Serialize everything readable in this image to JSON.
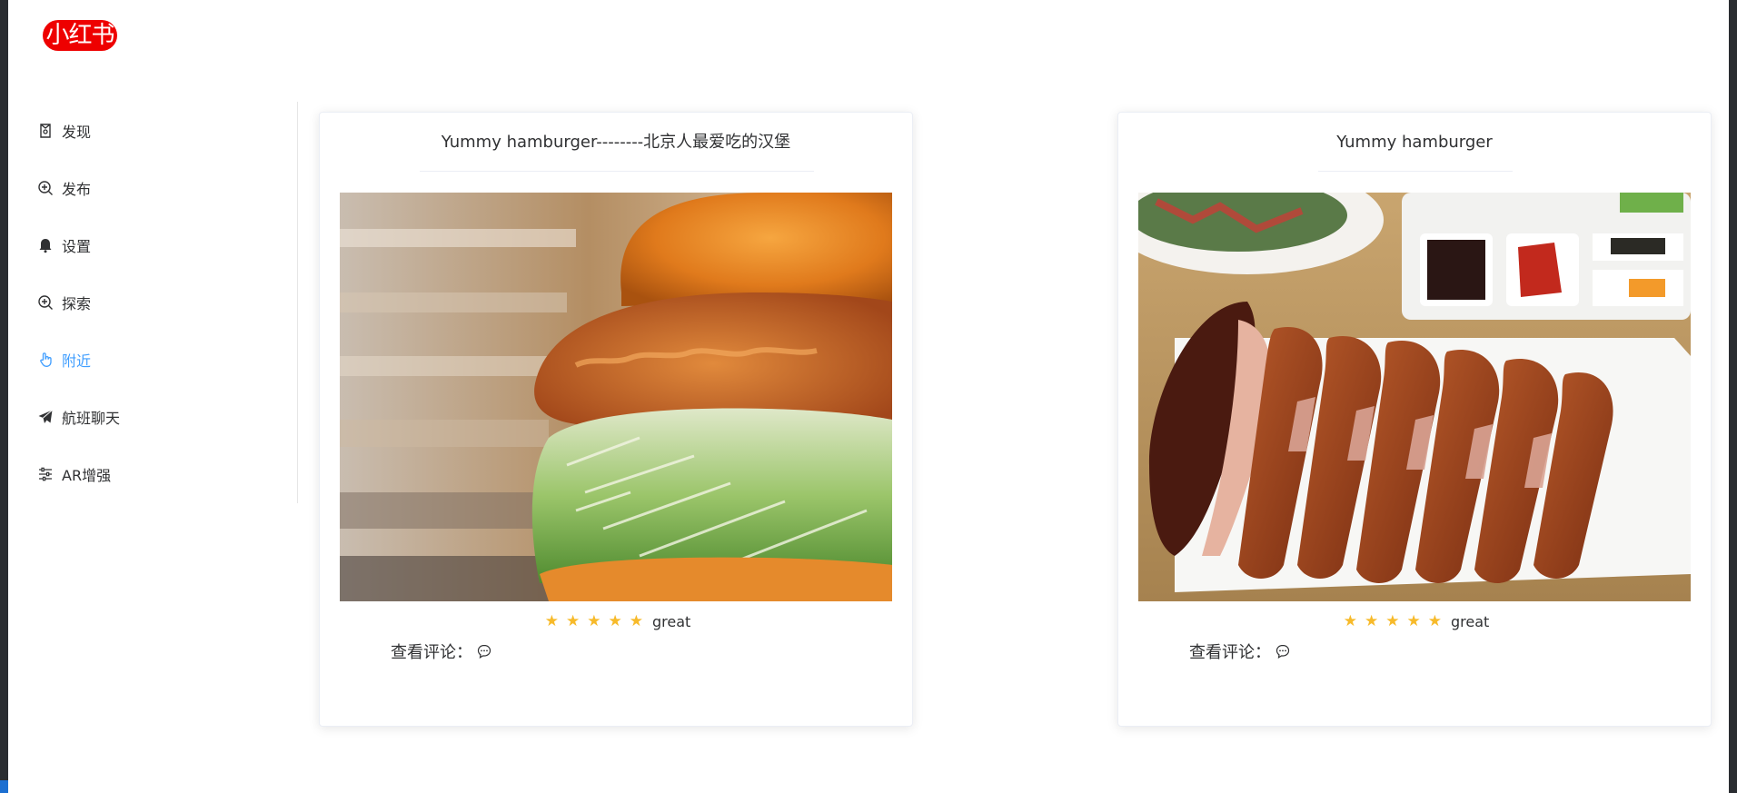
{
  "app": {
    "logo_text": "小红书",
    "brand_color": "#ee0000",
    "accent_color": "#409eff"
  },
  "sidebar": {
    "items": [
      {
        "label": "发现",
        "icon": "discover-icon",
        "active": false
      },
      {
        "label": "发布",
        "icon": "publish-icon",
        "active": false
      },
      {
        "label": "设置",
        "icon": "bell-icon",
        "active": false
      },
      {
        "label": "探索",
        "icon": "zoom-icon",
        "active": false
      },
      {
        "label": "附近",
        "icon": "pointer-icon",
        "active": true
      },
      {
        "label": "航班聊天",
        "icon": "paper-plane-icon",
        "active": false
      },
      {
        "label": "AR增强",
        "icon": "sliders-icon",
        "active": false
      }
    ]
  },
  "cards": [
    {
      "title": "Yummy hamburger--------北京人最爱吃的汉堡",
      "image": "fried-chicken-burger-photo",
      "rating": 5,
      "rating_text": "great",
      "comments_label": "查看评论："
    },
    {
      "title": "Yummy hamburger",
      "image": "peking-duck-photo",
      "rating": 5,
      "rating_text": "great",
      "comments_label": "查看评论："
    }
  ],
  "star_color": "#f7ba2a"
}
